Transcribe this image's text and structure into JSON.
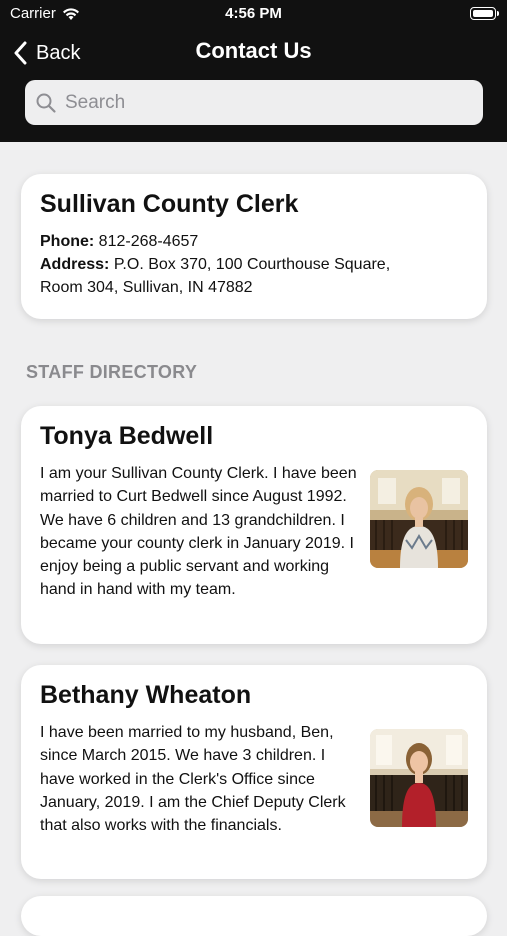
{
  "status_bar": {
    "carrier": "Carrier",
    "time": "4:56 PM",
    "icons": [
      "wifi-icon",
      "battery-icon"
    ]
  },
  "nav": {
    "back_label": "Back",
    "title": "Contact Us",
    "back_icon": "chevron-left-icon"
  },
  "search": {
    "placeholder": "Search",
    "value": "",
    "icon": "search-icon"
  },
  "office": {
    "name": "Sullivan County Clerk",
    "phone_label": "Phone:",
    "phone": "812-268-4657",
    "address_label": "Address:",
    "address_line1": "P.O. Box 370, 100 Courthouse Square,",
    "address_line2": "Room 304, Sullivan, IN  47882"
  },
  "staff_section_title": "STAFF DIRECTORY",
  "staff": [
    {
      "name": "Tonya Bedwell",
      "bio": "I am your Sullivan County Clerk.  I have been married to Curt Bedwell since August 1992.  We have 6 children and 13 grandchildren.    I became your county clerk in January 2019.  I  enjoy being a public servant and working hand in hand with my team."
    },
    {
      "name": "Bethany Wheaton",
      "bio": "I have been married to my husband, Ben, since March 2015.  We have 3 children.  I have worked in the Clerk's Office since January, 2019.  I am the Chief Deputy Clerk that also works with the financials."
    }
  ],
  "colors": {
    "header_bg": "#111111",
    "page_bg": "#efeff0",
    "card_bg": "#ffffff",
    "section_header": "#8a8a8e"
  }
}
